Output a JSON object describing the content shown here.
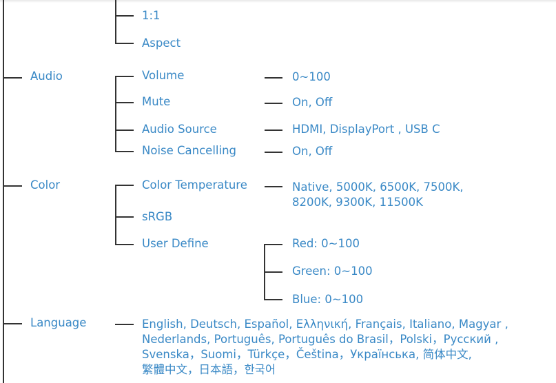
{
  "picture": {
    "items": [
      "1:1",
      "Aspect"
    ]
  },
  "audio": {
    "label": "Audio",
    "items": [
      {
        "label": "Volume",
        "value": "0~100"
      },
      {
        "label": "Mute",
        "value": "On, Off"
      },
      {
        "label": "Audio Source",
        "value": "HDMI, DisplayPort , USB C"
      },
      {
        "label": "Noise Cancelling",
        "value": "On, Off"
      }
    ]
  },
  "color": {
    "label": "Color",
    "items": [
      {
        "label": "Color Temperature",
        "value_line1": "Native, 5000K, 6500K, 7500K,",
        "value_line2": "8200K, 9300K, 11500K"
      },
      {
        "label": "sRGB"
      },
      {
        "label": "User Define",
        "values": [
          "Red: 0~100",
          "Green: 0~100",
          "Blue: 0~100"
        ]
      }
    ]
  },
  "language": {
    "label": "Language",
    "lines": [
      "English, Deutsch, Español, Ελληνική, Français, Italiano,  Magyar ,",
      "Nederlands, Português, Português do Brasil，Polski，Русский ,",
      "Svenska，Suomi，Türkçe，Čeština，Українська, 简体中文,",
      "繁體中文，日本語，한국어"
    ]
  },
  "colors": {
    "text": "#3a89c6",
    "lines": "#333333"
  }
}
